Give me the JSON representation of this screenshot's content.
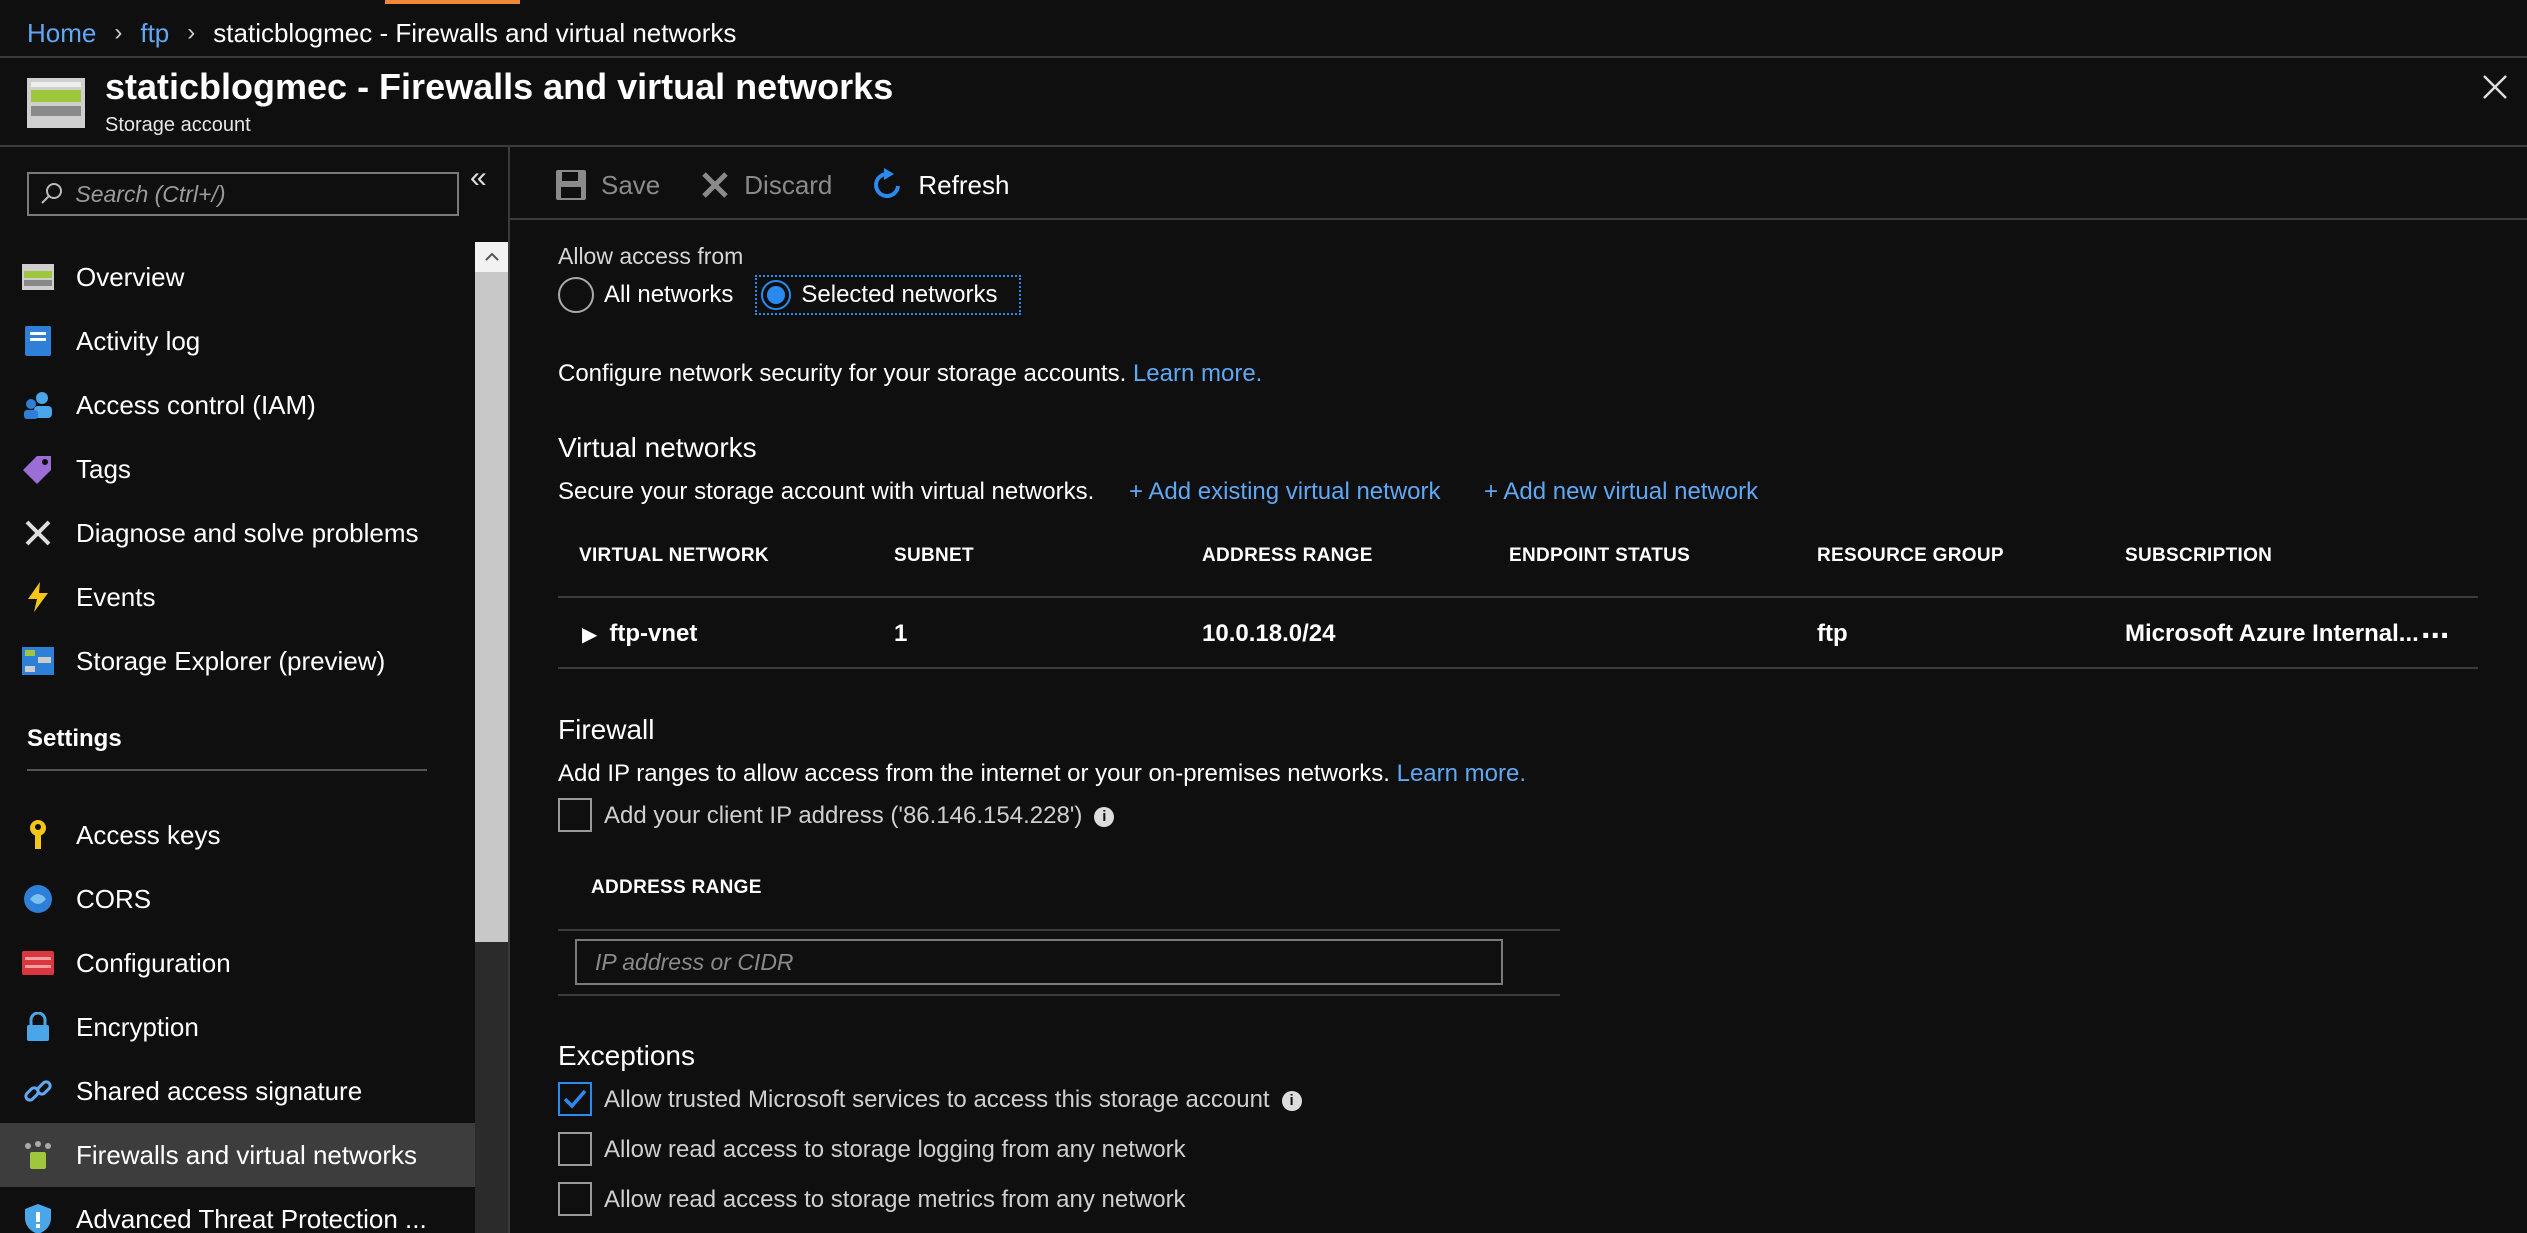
{
  "breadcrumb": {
    "home": "Home",
    "ftp": "ftp",
    "current": "staticblogmec - Firewalls and virtual networks"
  },
  "header": {
    "title": "staticblogmec - Firewalls and virtual networks",
    "subtitle": "Storage account"
  },
  "sidebar": {
    "search_placeholder": "Search (Ctrl+/)",
    "items": [
      {
        "label": "Overview",
        "icon": "storage-icon"
      },
      {
        "label": "Activity log",
        "icon": "log-icon"
      },
      {
        "label": "Access control (IAM)",
        "icon": "users-icon"
      },
      {
        "label": "Tags",
        "icon": "tag-icon"
      },
      {
        "label": "Diagnose and solve problems",
        "icon": "wrench-icon"
      },
      {
        "label": "Events",
        "icon": "lightning-icon"
      },
      {
        "label": "Storage Explorer (preview)",
        "icon": "explorer-icon"
      }
    ],
    "settings_heading": "Settings",
    "settings_items": [
      {
        "label": "Access keys",
        "icon": "key-icon"
      },
      {
        "label": "CORS",
        "icon": "cors-icon"
      },
      {
        "label": "Configuration",
        "icon": "config-icon"
      },
      {
        "label": "Encryption",
        "icon": "lock-icon"
      },
      {
        "label": "Shared access signature",
        "icon": "link-icon"
      },
      {
        "label": "Firewalls and virtual networks",
        "icon": "firewall-icon"
      },
      {
        "label": "Advanced Threat Protection ...",
        "icon": "shield-icon"
      }
    ]
  },
  "toolbar": {
    "save": "Save",
    "discard": "Discard",
    "refresh": "Refresh"
  },
  "access": {
    "label": "Allow access from",
    "all_networks": "All networks",
    "selected_networks": "Selected networks",
    "description": "Configure network security for your storage accounts.",
    "learn_more": "Learn more."
  },
  "vnets": {
    "heading": "Virtual networks",
    "description": "Secure your storage account with virtual networks.",
    "add_existing": "+ Add existing virtual network",
    "add_new": "+ Add new virtual network",
    "columns": [
      "VIRTUAL NETWORK",
      "SUBNET",
      "ADDRESS RANGE",
      "ENDPOINT STATUS",
      "RESOURCE GROUP",
      "SUBSCRIPTION"
    ],
    "rows": [
      {
        "network": "ftp-vnet",
        "subnet": "1",
        "address_range": "10.0.18.0/24",
        "endpoint_status": "",
        "resource_group": "ftp",
        "subscription": "Microsoft Azure Internal..."
      }
    ],
    "more": "..."
  },
  "firewall": {
    "heading": "Firewall",
    "description": "Add IP ranges to allow access from the internet or your on-premises networks.",
    "learn_more": "Learn more.",
    "client_ip_label": "Add your client IP address ('86.146.154.228')",
    "address_range_header": "ADDRESS RANGE",
    "ip_placeholder": "IP address or CIDR"
  },
  "exceptions": {
    "heading": "Exceptions",
    "items": [
      {
        "label": "Allow trusted Microsoft services to access this storage account",
        "checked": true
      },
      {
        "label": "Allow read access to storage logging from any network",
        "checked": false
      },
      {
        "label": "Allow read access to storage metrics from any network",
        "checked": false
      }
    ]
  },
  "colors": {
    "accent": "#2a8af0",
    "link": "#5ea8f5",
    "top_accent": "#f0883a"
  }
}
